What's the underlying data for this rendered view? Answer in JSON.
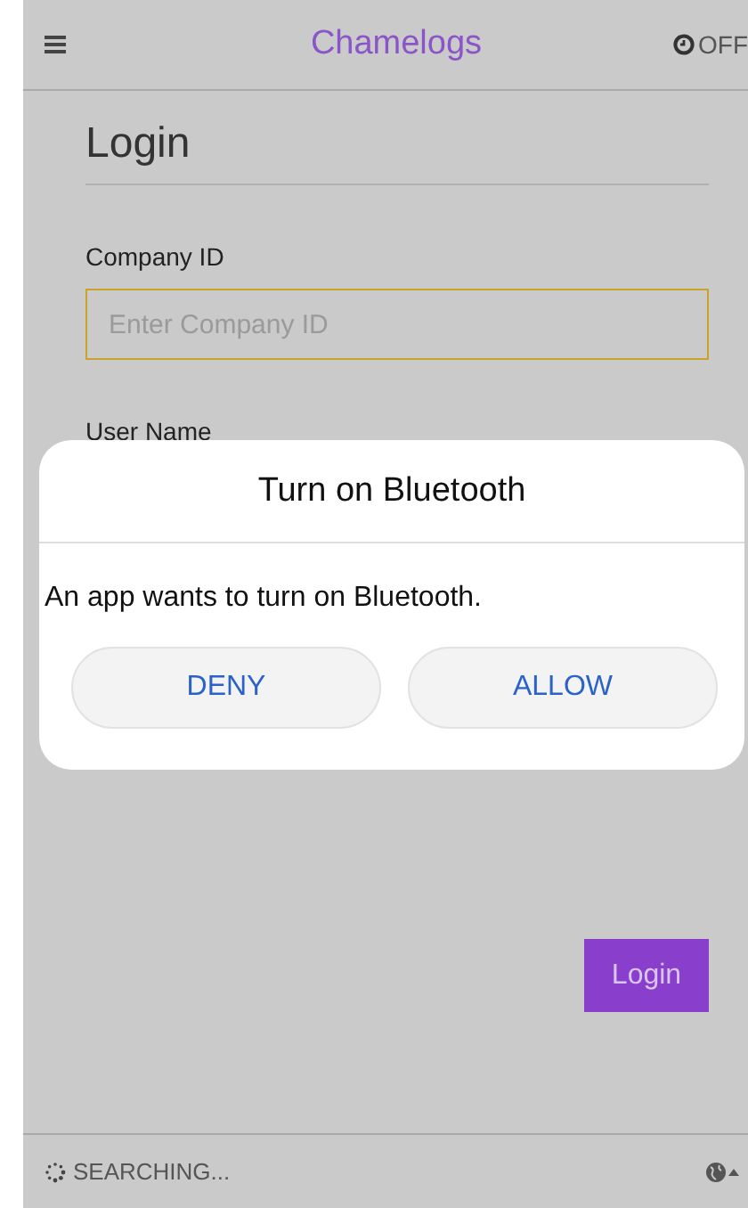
{
  "header": {
    "title": "Chamelogs",
    "status": "OFF"
  },
  "form": {
    "title": "Login",
    "fields": [
      {
        "label": "Company ID",
        "placeholder": "Enter Company ID",
        "focused": true
      },
      {
        "label": "User Name"
      }
    ],
    "submit": "Login"
  },
  "dialog": {
    "title": "Turn on Bluetooth",
    "message": "An app wants to turn on Bluetooth.",
    "buttons": [
      "DENY",
      "ALLOW"
    ]
  },
  "status_bar": {
    "text": "SEARCHING..."
  }
}
